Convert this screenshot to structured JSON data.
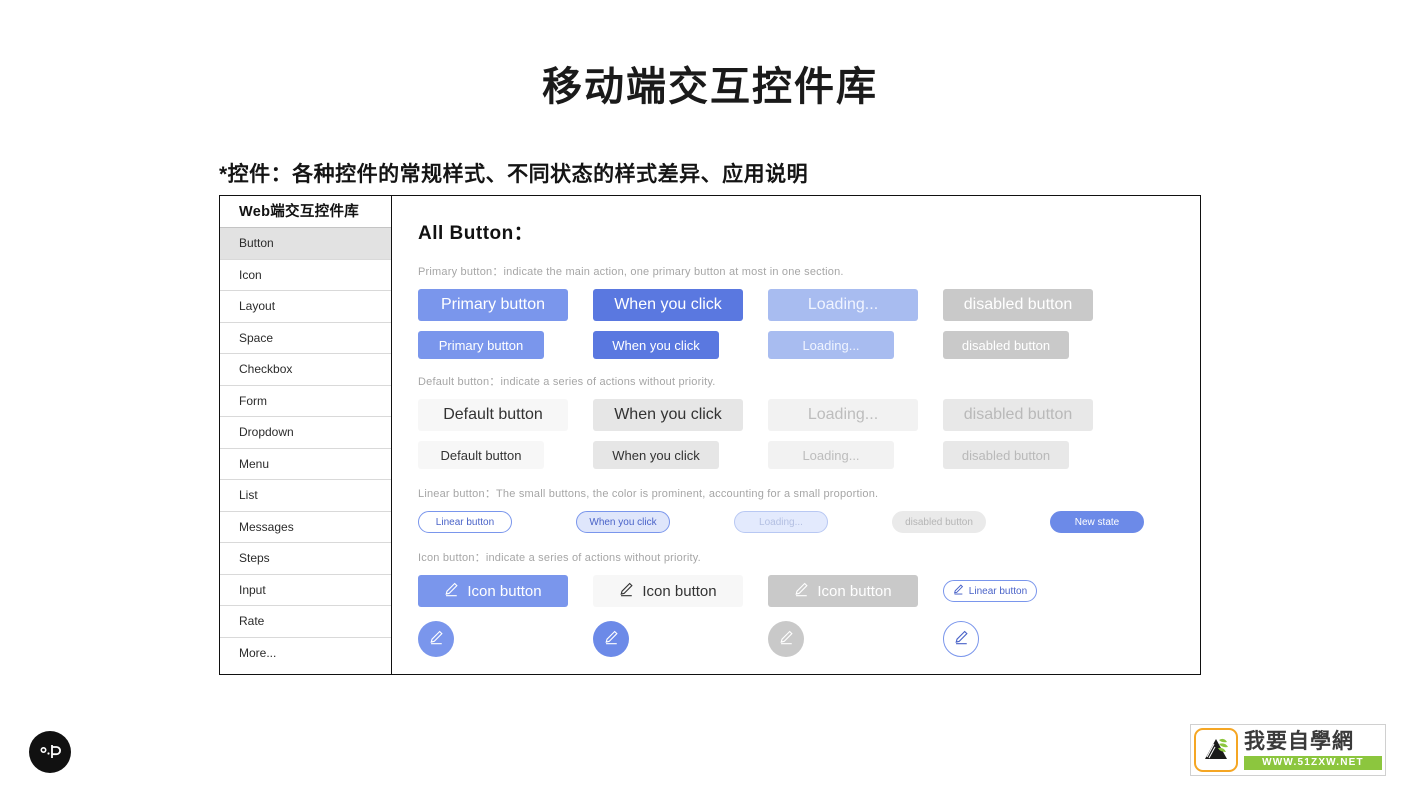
{
  "page": {
    "main_title": "移动端交互控件库",
    "subtitle": "*控件：各种控件的常规样式、不同状态的样式差异、应用说明"
  },
  "sidebar": {
    "header": "Web端交互控件库",
    "items": [
      {
        "label": "Button",
        "active": true
      },
      {
        "label": "Icon",
        "active": false
      },
      {
        "label": "Layout",
        "active": false
      },
      {
        "label": "Space",
        "active": false
      },
      {
        "label": "Checkbox",
        "active": false
      },
      {
        "label": "Form",
        "active": false
      },
      {
        "label": "Dropdown",
        "active": false
      },
      {
        "label": "Menu",
        "active": false
      },
      {
        "label": "List",
        "active": false
      },
      {
        "label": "Messages",
        "active": false
      },
      {
        "label": "Steps",
        "active": false
      },
      {
        "label": "Input",
        "active": false
      },
      {
        "label": "Rate",
        "active": false
      },
      {
        "label": "More...",
        "active": false
      }
    ]
  },
  "content": {
    "title": "All Button：",
    "sections": {
      "primary": {
        "helper": "Primary button：indicate the main action, one primary button at most in one section.",
        "large": [
          {
            "label": "Primary button",
            "state": "normal"
          },
          {
            "label": "When you click",
            "state": "active"
          },
          {
            "label": "Loading...",
            "state": "loading"
          },
          {
            "label": "disabled button",
            "state": "disabled"
          }
        ],
        "small": [
          {
            "label": "Primary button",
            "state": "normal"
          },
          {
            "label": "When you click",
            "state": "active"
          },
          {
            "label": "Loading...",
            "state": "loading"
          },
          {
            "label": "disabled button",
            "state": "disabled"
          }
        ]
      },
      "default": {
        "helper": "Default button：indicate a series of actions without priority.",
        "large": [
          {
            "label": "Default button",
            "state": "normal"
          },
          {
            "label": "When you click",
            "state": "active"
          },
          {
            "label": "Loading...",
            "state": "loading"
          },
          {
            "label": "disabled button",
            "state": "disabled"
          }
        ],
        "small": [
          {
            "label": "Default button",
            "state": "normal"
          },
          {
            "label": "When you click",
            "state": "active"
          },
          {
            "label": "Loading...",
            "state": "loading"
          },
          {
            "label": "disabled button",
            "state": "disabled"
          }
        ]
      },
      "linear": {
        "helper": "Linear button：The small buttons, the color is prominent, accounting for a small proportion.",
        "items": [
          {
            "label": "Linear button",
            "state": "normal"
          },
          {
            "label": "When you click",
            "state": "active"
          },
          {
            "label": "Loading...",
            "state": "loading"
          },
          {
            "label": "disabled button",
            "state": "disabled"
          },
          {
            "label": "New state",
            "state": "new"
          }
        ]
      },
      "icon": {
        "helper": "Icon button：indicate a series of actions without priority.",
        "items": [
          {
            "label": "Icon button",
            "state": "normal",
            "icon": "pencil-icon"
          },
          {
            "label": "Icon button",
            "state": "default",
            "icon": "pencil-icon"
          },
          {
            "label": "Icon button",
            "state": "disabled",
            "icon": "pencil-icon"
          },
          {
            "label": "Linear button",
            "state": "linear",
            "icon": "pencil-icon"
          }
        ],
        "circles": [
          {
            "state": "normal",
            "icon": "pencil-icon"
          },
          {
            "state": "active",
            "icon": "pencil-icon"
          },
          {
            "state": "disabled",
            "icon": "pencil-icon"
          },
          {
            "state": "linear",
            "icon": "pencil-icon"
          }
        ]
      }
    }
  },
  "watermark": {
    "brand_cn": "我要自學網",
    "url": "WWW.51ZXW.NET",
    "icon": "plant-logo-icon"
  },
  "bottom_logo": {
    "icon": "circular-brand-icon"
  },
  "colors": {
    "primary": "#7a96ec",
    "primary_active": "#5a78e0",
    "primary_loading": "#a8bcf0",
    "disabled": "#c9c9c9",
    "default_bg": "#f7f7f7",
    "default_active": "#e6e6e6",
    "accent_green": "#8cc63e",
    "accent_orange": "#f5a623"
  }
}
